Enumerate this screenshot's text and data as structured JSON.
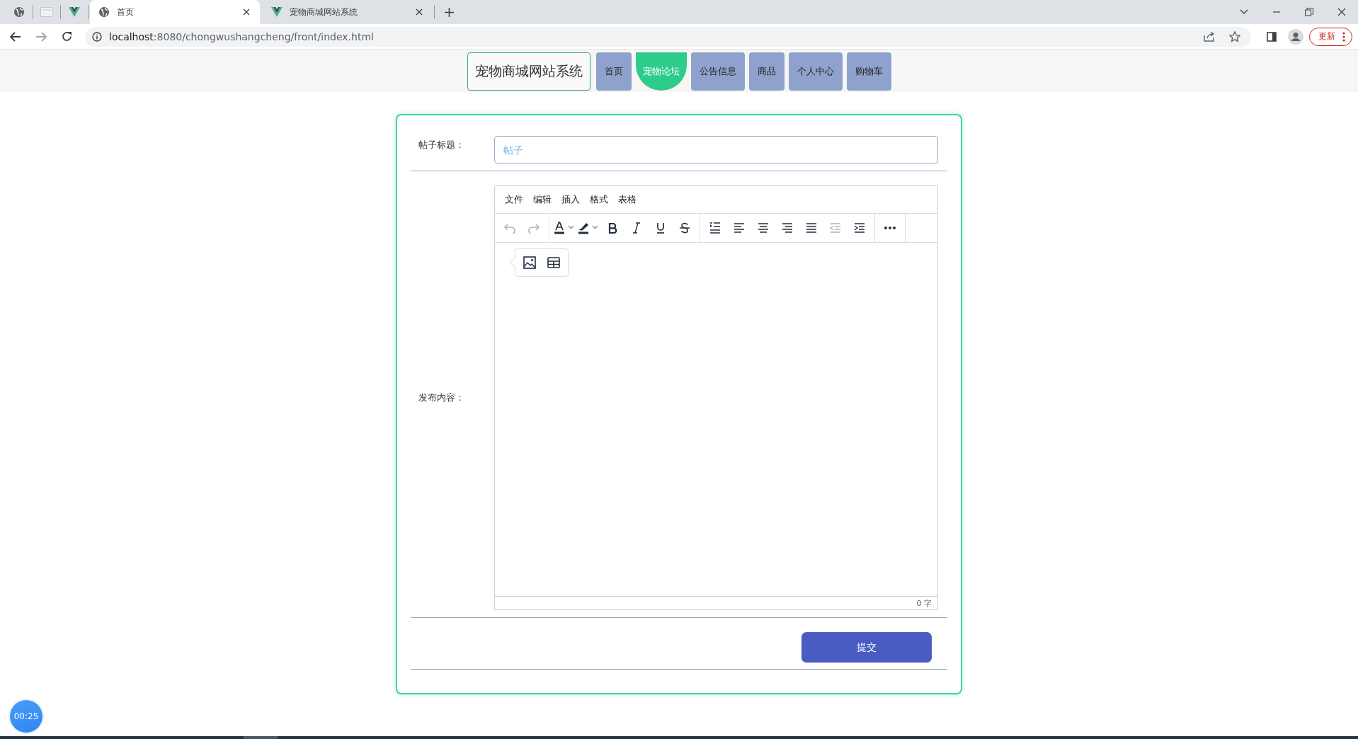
{
  "browser": {
    "pinned_tabs": [
      {
        "kind": "globe"
      },
      {
        "kind": "blank"
      },
      {
        "kind": "vue"
      }
    ],
    "tabs": [
      {
        "title": "首页",
        "kind": "globe",
        "selected": true
      },
      {
        "title": "宠物商城网站系统",
        "kind": "vue",
        "selected": false
      }
    ],
    "address": {
      "host": "localhost",
      "path": ":8080/chongwushangcheng/front/index.html"
    },
    "update_button": "更新"
  },
  "nav": {
    "brand": "宠物商城网站系统",
    "items": [
      {
        "label": "首页",
        "selected": false
      },
      {
        "label": "宠物论坛",
        "selected": true
      },
      {
        "label": "公告信息",
        "selected": false
      },
      {
        "label": "商品",
        "selected": false
      },
      {
        "label": "个人中心",
        "selected": false
      },
      {
        "label": "购物车",
        "selected": false
      }
    ]
  },
  "form": {
    "title_label": "帖子标题：",
    "title_placeholder": "帖子",
    "content_label": "发布内容：",
    "editor": {
      "menus": [
        "文件",
        "编辑",
        "插入",
        "格式",
        "表格"
      ],
      "toolbar": [
        [
          {
            "kind": "undo",
            "disabled": true
          },
          {
            "kind": "redo",
            "disabled": true
          }
        ],
        [
          {
            "kind": "text-color",
            "disabled": false
          },
          {
            "kind": "highlight",
            "disabled": false
          },
          {
            "kind": "bold",
            "disabled": false
          },
          {
            "kind": "italic",
            "disabled": false
          },
          {
            "kind": "underline",
            "disabled": false
          },
          {
            "kind": "strikethrough",
            "disabled": false
          }
        ],
        [
          {
            "kind": "line-height",
            "disabled": false
          },
          {
            "kind": "align-left",
            "disabled": false
          },
          {
            "kind": "align-center",
            "disabled": false
          },
          {
            "kind": "align-right",
            "disabled": false
          },
          {
            "kind": "justify",
            "disabled": false
          },
          {
            "kind": "outdent",
            "disabled": true
          },
          {
            "kind": "indent",
            "disabled": false
          }
        ],
        [
          {
            "kind": "more",
            "disabled": false
          }
        ]
      ],
      "quickbar": [
        {
          "kind": "image"
        },
        {
          "kind": "table"
        }
      ],
      "word_count": "0 字"
    },
    "submit": "提交"
  },
  "timer": "00:25"
}
